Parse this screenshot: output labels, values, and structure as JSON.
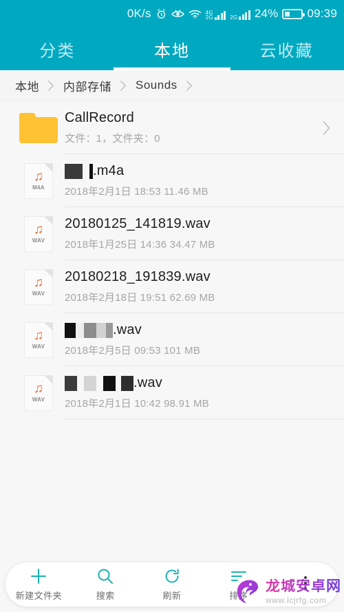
{
  "statusbar": {
    "network_speed": "0K/s",
    "icons": [
      "alarm-icon",
      "eye-icon",
      "wifi-icon",
      "signal-4g-icon",
      "signal-2g-icon"
    ],
    "battery_percent": "24%",
    "time": "09:39",
    "bg_color": "#00a9c0"
  },
  "tabs": [
    {
      "label": "分类",
      "active": false
    },
    {
      "label": "本地",
      "active": true
    },
    {
      "label": "云收藏",
      "active": false
    }
  ],
  "breadcrumb": {
    "items": [
      "本地",
      "内部存储",
      "Sounds"
    ],
    "trailing_separator": true
  },
  "list": [
    {
      "kind": "folder",
      "icon": "folder-icon",
      "name": "CallRecord",
      "name_prefix_redactions": [],
      "subtitle": "文件：1，文件夹：0",
      "chevron": true
    },
    {
      "kind": "file",
      "icon": "music-file-icon",
      "ext_label": "M4A",
      "name": ".m4a",
      "name_prefix_redactions": [
        {
          "width": 26,
          "color": "#3a3a3a"
        },
        {
          "width": 10,
          "color": "#f7f7f7"
        },
        {
          "width": 5,
          "color": "#111111"
        }
      ],
      "subtitle": "2018年2月1日 18:53 11.46 MB",
      "chevron": false
    },
    {
      "kind": "file",
      "icon": "music-file-icon",
      "ext_label": "WAV",
      "name": "20180125_141819.wav",
      "name_prefix_redactions": [],
      "subtitle": "2018年1月25日 14:36 34.47 MB",
      "chevron": false
    },
    {
      "kind": "file",
      "icon": "music-file-icon",
      "ext_label": "WAV",
      "name": "20180218_191839.wav",
      "name_prefix_redactions": [],
      "subtitle": "2018年2月18日 19:51 62.69 MB",
      "chevron": false
    },
    {
      "kind": "file",
      "icon": "music-file-icon",
      "ext_label": "WAV",
      "name": ".wav",
      "name_prefix_redactions": [
        {
          "width": 16,
          "color": "#111111"
        },
        {
          "width": 12,
          "color": "#eeeeee"
        },
        {
          "width": 18,
          "color": "#8d8d8d"
        },
        {
          "width": 14,
          "color": "#d2d2d2"
        },
        {
          "width": 10,
          "color": "#9a9a9a"
        }
      ],
      "subtitle": "2018年2月5日 09:53 101 MB",
      "chevron": false
    },
    {
      "kind": "file",
      "icon": "music-file-icon",
      "ext_label": "WAV",
      "name": ".wav",
      "name_prefix_redactions": [
        {
          "width": 18,
          "color": "#3c3c3c"
        },
        {
          "width": 10,
          "color": "#f7f7f7"
        },
        {
          "width": 18,
          "color": "#d4d4d4"
        },
        {
          "width": 10,
          "color": "#f7f7f7"
        },
        {
          "width": 18,
          "color": "#111111"
        },
        {
          "width": 8,
          "color": "#f7f7f7"
        },
        {
          "width": 18,
          "color": "#2e2e2e"
        }
      ],
      "subtitle": "2018年2月1日 10:42 98.91 MB",
      "chevron": false
    }
  ],
  "bottombar": {
    "items": [
      {
        "icon": "plus-icon",
        "label": "新建文件夹"
      },
      {
        "icon": "search-icon",
        "label": "搜索"
      },
      {
        "icon": "refresh-icon",
        "label": "刷新"
      },
      {
        "icon": "sort-icon",
        "label": "排序"
      },
      {
        "icon": "more-vertical-icon",
        "label": ""
      }
    ],
    "accent_color": "#18b3b3"
  },
  "watermark": {
    "logo": "dragon-logo-icon",
    "title": "龙城安卓网",
    "url": "www.lcjrfg.com"
  }
}
